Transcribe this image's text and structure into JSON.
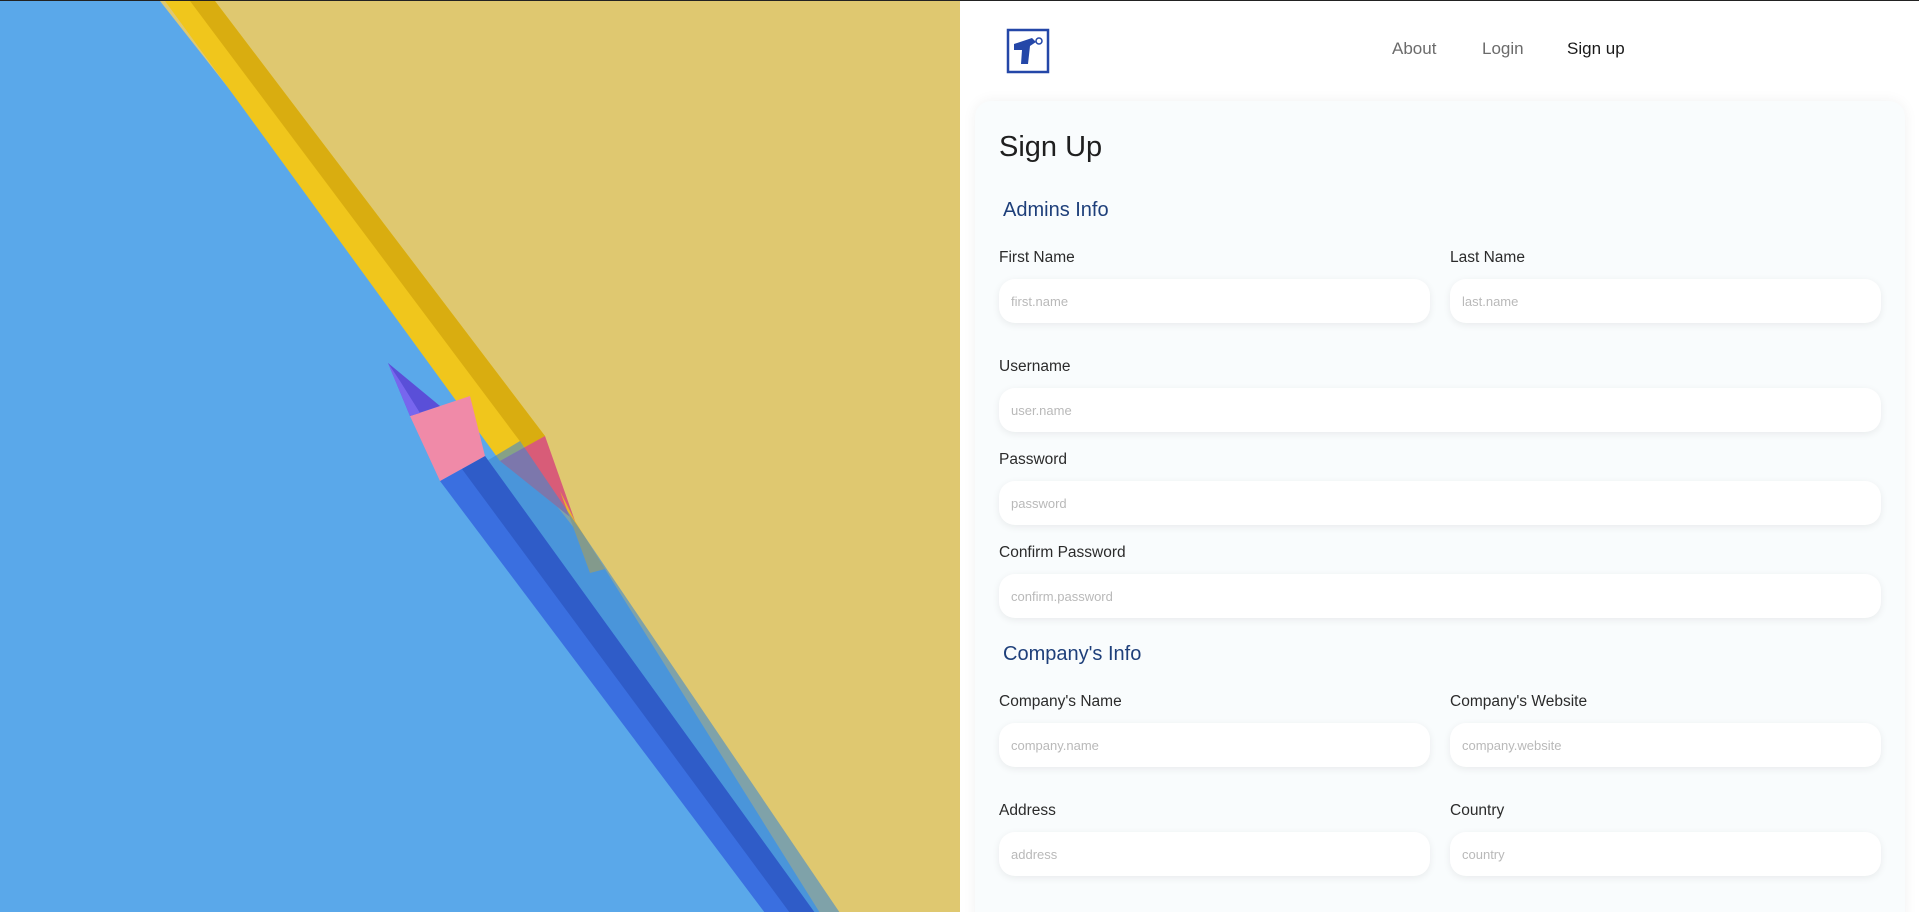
{
  "nav": {
    "about": "About",
    "login": "Login",
    "signup": "Sign up"
  },
  "form": {
    "title": "Sign Up",
    "admins_section": "Admins Info",
    "company_section": "Company's Info",
    "fields": {
      "first_name": {
        "label": "First Name",
        "placeholder": "first.name",
        "value": ""
      },
      "last_name": {
        "label": "Last Name",
        "placeholder": "last.name",
        "value": ""
      },
      "username": {
        "label": "Username",
        "placeholder": "user.name",
        "value": ""
      },
      "password": {
        "label": "Password",
        "placeholder": "password",
        "value": ""
      },
      "confirm_password": {
        "label": "Confirm Password",
        "placeholder": "confirm.password",
        "value": ""
      },
      "company_name": {
        "label": "Company's Name",
        "placeholder": "company.name",
        "value": ""
      },
      "company_website": {
        "label": "Company's Website",
        "placeholder": "company.website",
        "value": ""
      },
      "address": {
        "label": "Address",
        "placeholder": "address",
        "value": ""
      },
      "country": {
        "label": "Country",
        "placeholder": "country",
        "value": ""
      }
    }
  },
  "colors": {
    "accent": "#1e3f7a",
    "logo_blue": "#2447a8",
    "hero_blue": "#5aa8ea",
    "hero_yellow": "#dfc870",
    "card_bg": "#f9fcfd"
  },
  "icons": {
    "logo": "brand-logo-icon"
  }
}
